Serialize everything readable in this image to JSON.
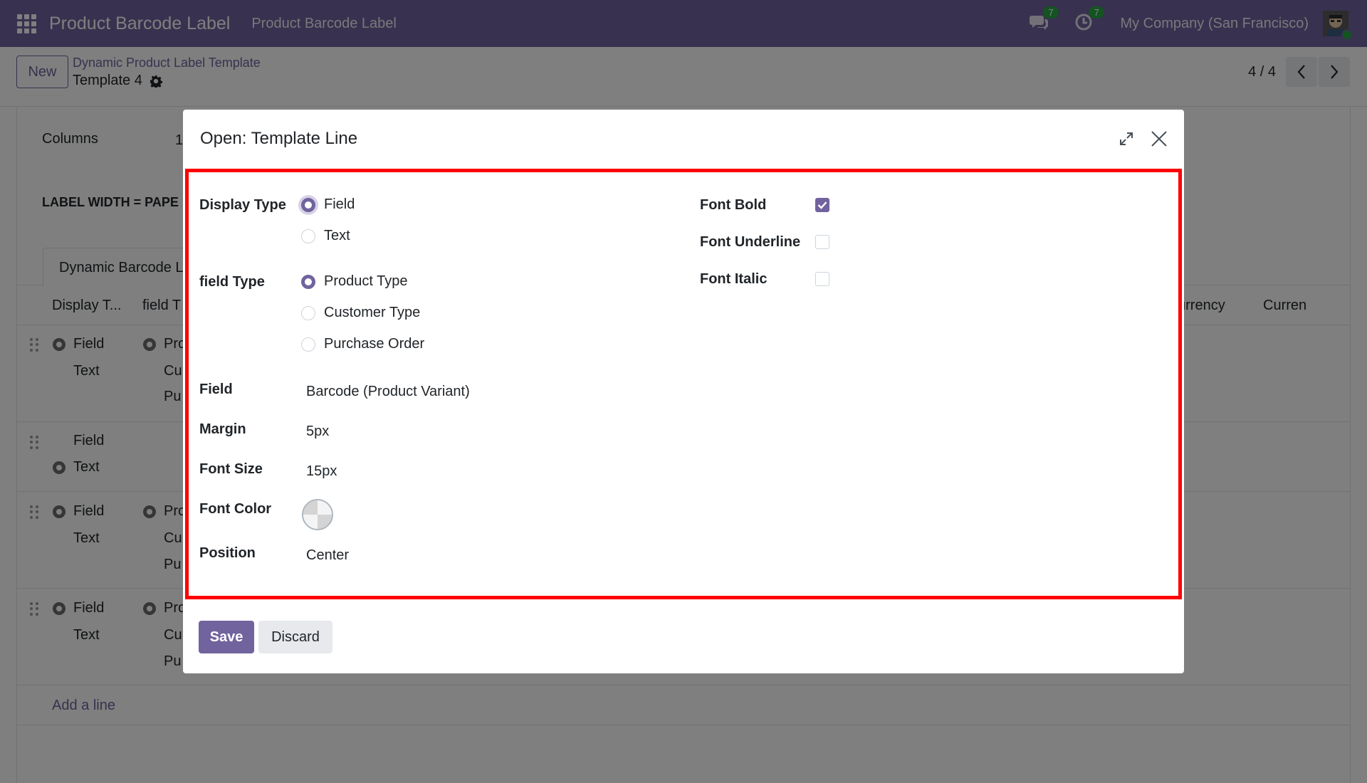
{
  "navbar": {
    "app_title": "Product Barcode Label",
    "menu_item": "Product Barcode Label",
    "messages_count": "7",
    "activities_count": "7",
    "company": "My Company (San Francisco)"
  },
  "control_panel": {
    "new_label": "New",
    "breadcrumb": "Dynamic Product Label Template",
    "record_name": "Template 4",
    "pager_value": "4 / 4"
  },
  "background_form": {
    "columns_label": "Columns",
    "columns_value": "1",
    "label_width_note": "LABEL WIDTH = PAPE",
    "tab_label": "Dynamic Barcode L",
    "col_display_type": "Display T...",
    "col_field_type": "field T",
    "col_currency_1": "urrency",
    "col_currency_2": "Curren",
    "rows": [
      {
        "a": "Field",
        "b": "Text",
        "c1": "Pro",
        "c2": "Cu",
        "c3": "Pu"
      },
      {
        "a": "Field",
        "b": "Text"
      },
      {
        "a": "Field",
        "b": "Text",
        "c1": "Pro",
        "c2": "Cu",
        "c3": "Pu"
      },
      {
        "a": "Field",
        "b": "Text",
        "c1": "Pro",
        "c2": "Cu",
        "c3": "Pu"
      }
    ],
    "add_line": "Add a line"
  },
  "dialog": {
    "title": "Open: Template Line",
    "display_type": {
      "label": "Display Type",
      "options": [
        "Field",
        "Text"
      ],
      "selected": "Field"
    },
    "field_type": {
      "label": "field Type",
      "options": [
        "Product Type",
        "Customer Type",
        "Purchase Order"
      ],
      "selected": "Product Type"
    },
    "field": {
      "label": "Field",
      "value": "Barcode (Product Variant)"
    },
    "margin": {
      "label": "Margin",
      "value": "5px"
    },
    "font_size": {
      "label": "Font Size",
      "value": "15px"
    },
    "font_color": {
      "label": "Font Color"
    },
    "position": {
      "label": "Position",
      "value": "Center"
    },
    "font_bold": {
      "label": "Font Bold",
      "checked": true
    },
    "font_underline": {
      "label": "Font Underline",
      "checked": false
    },
    "font_italic": {
      "label": "Font Italic",
      "checked": false
    },
    "save_label": "Save",
    "discard_label": "Discard"
  },
  "colors": {
    "brand": "#71639e",
    "highlight": "#ff0000",
    "badge": "#28a745"
  }
}
